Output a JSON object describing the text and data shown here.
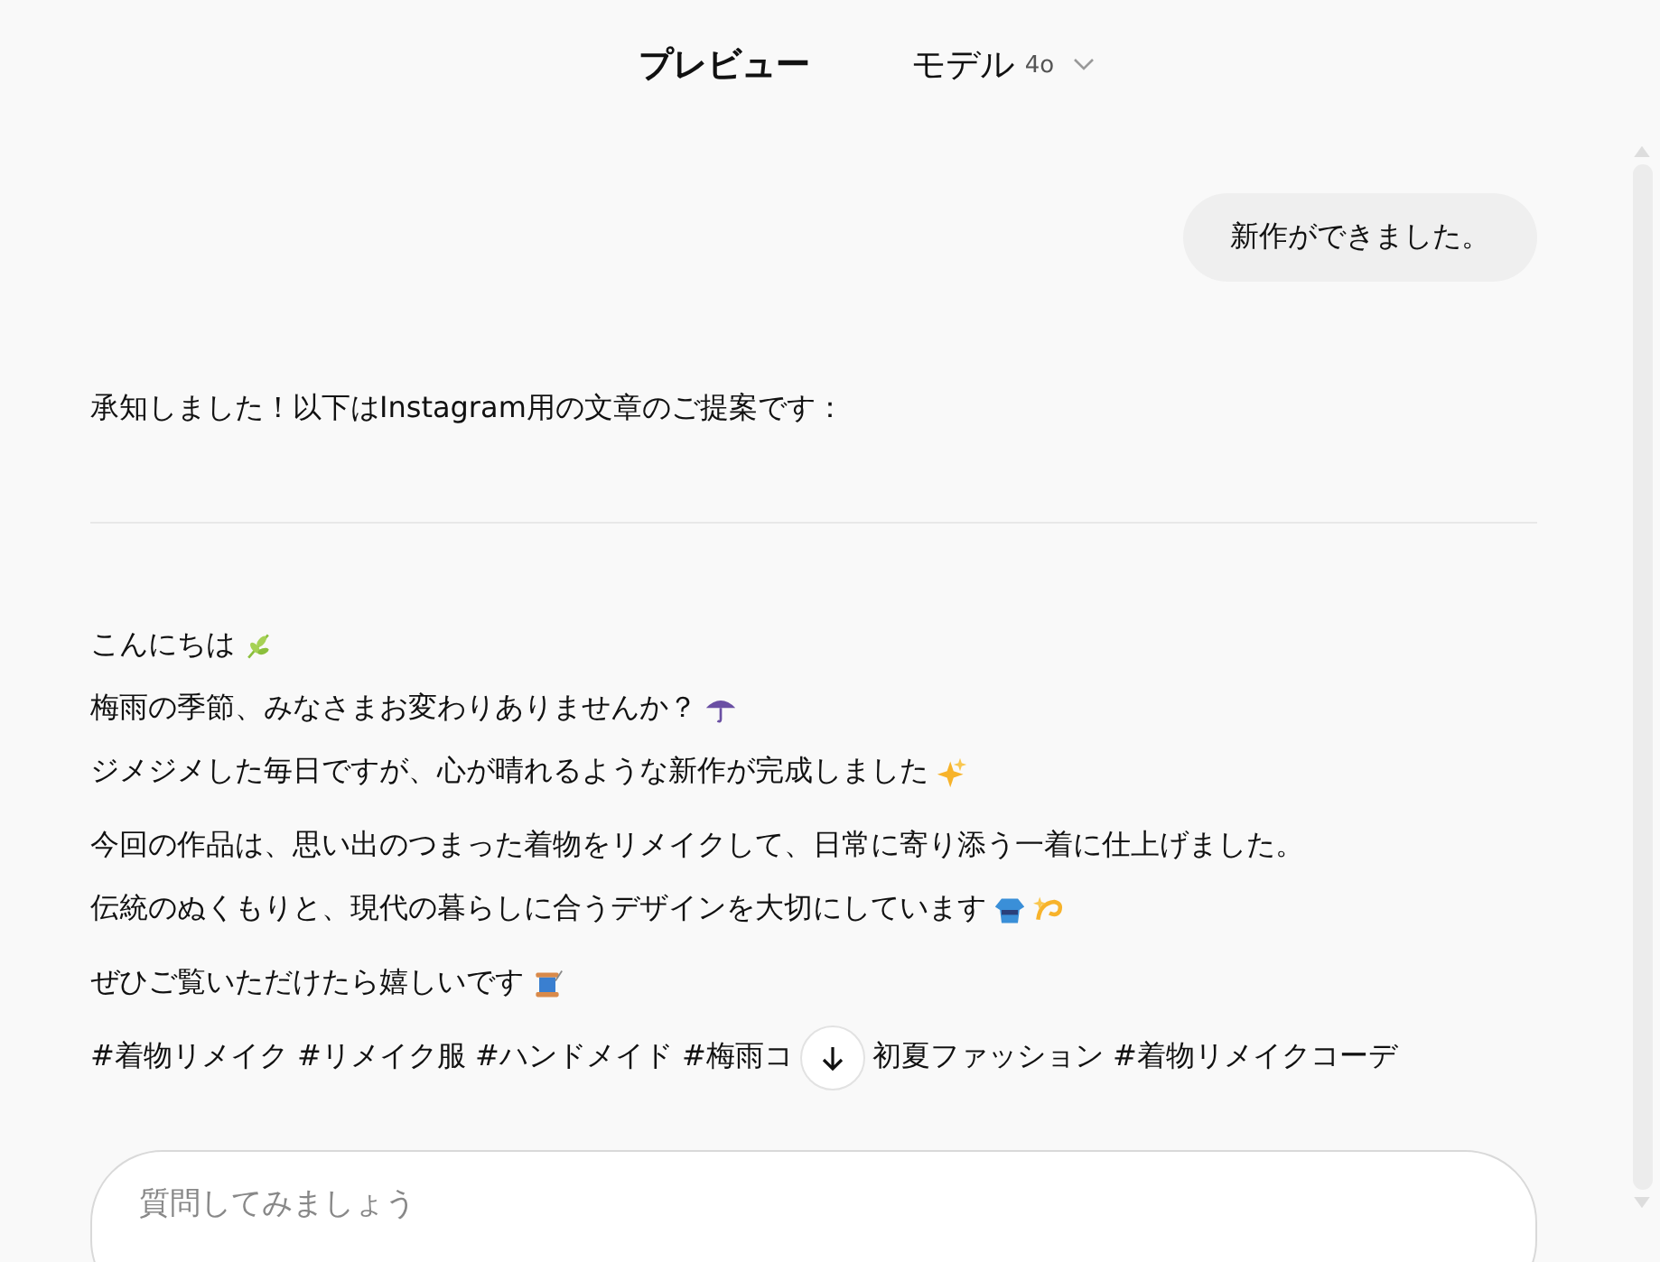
{
  "header": {
    "title": "プレビュー",
    "model_label": "モデル",
    "model_value": "4o"
  },
  "messages": [
    {
      "kind": "user",
      "text": "新作ができました。"
    },
    {
      "kind": "assistant",
      "text": "承知しました！以下はInstagram用の文章のご提案です："
    }
  ],
  "post": {
    "paragraphs": [
      {
        "lines": [
          {
            "text": "こんにちは"
          },
          {
            "text": "梅雨の季節、みなさまお変わりありませんか？"
          },
          {
            "text": "ジメジメした毎日ですが、心が晴れるような新作が完成しました"
          }
        ]
      },
      {
        "lines": [
          {
            "text": "今回の作品は、思い出のつまった着物をリメイクして、日常に寄り添う一着に仕上げました。"
          },
          {
            "text": "伝統のぬくもりと、現代の暮らしに合うデザインを大切にしています"
          }
        ]
      },
      {
        "lines": [
          {
            "text": "ぜひご覧いただけたら嬉しいです"
          }
        ]
      }
    ],
    "hashtags_before": "#着物リメイク #リメイク服 #ハンドメイド #梅雨コ",
    "hashtags_after": "初夏ファッション #着物リメイクコーデ"
  },
  "input": {
    "placeholder": "質問してみましょう"
  }
}
